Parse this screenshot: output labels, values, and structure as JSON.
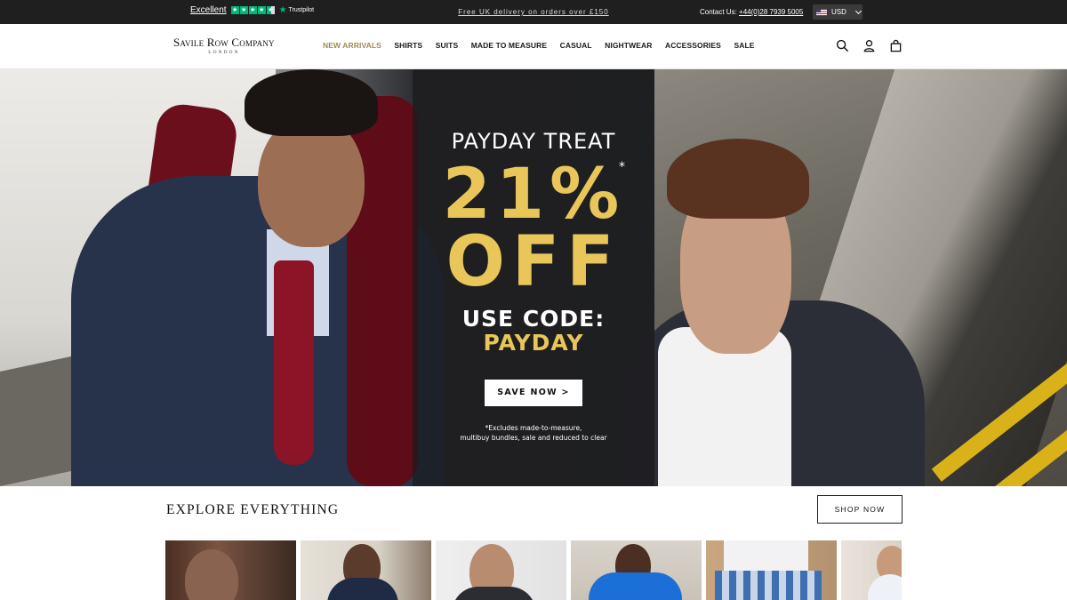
{
  "topbar": {
    "trustpilot_rating": "Excellent",
    "trustpilot_brand": "Trustpilot",
    "stars": 4.5,
    "promo": "Free UK delivery on orders over £150",
    "contact_label": "Contact Us:",
    "contact_phone": "+44(0)28 7939 5005",
    "currency": "USD"
  },
  "nav": {
    "logo_line1": "Savile Row Company",
    "logo_line2": "LONDON",
    "items": [
      "NEW ARRIVALS",
      "SHIRTS",
      "SUITS",
      "MADE TO MEASURE",
      "CASUAL",
      "NIGHTWEAR",
      "ACCESSORIES",
      "SALE"
    ],
    "icons": [
      "search-icon",
      "account-icon",
      "bag-icon"
    ]
  },
  "hero": {
    "headline": "PAYDAY TREAT",
    "discount_line1": "21%",
    "asterisk": "*",
    "discount_line2": "OFF",
    "code_label": "USE CODE:",
    "code": "PAYDAY",
    "cta": "SAVE NOW >",
    "disclaimer_line1": "*Excludes made-to-measure,",
    "disclaimer_line2": "multibuy bundles, sale and reduced to clear"
  },
  "explore": {
    "title": "EXPLORE EVERYTHING",
    "cta": "SHOP NOW"
  },
  "colors": {
    "accent_gold": "#e8c65a",
    "active_nav": "#a08a55",
    "topbar_bg": "#1f1f1f",
    "trustpilot_green": "#00b67a"
  }
}
